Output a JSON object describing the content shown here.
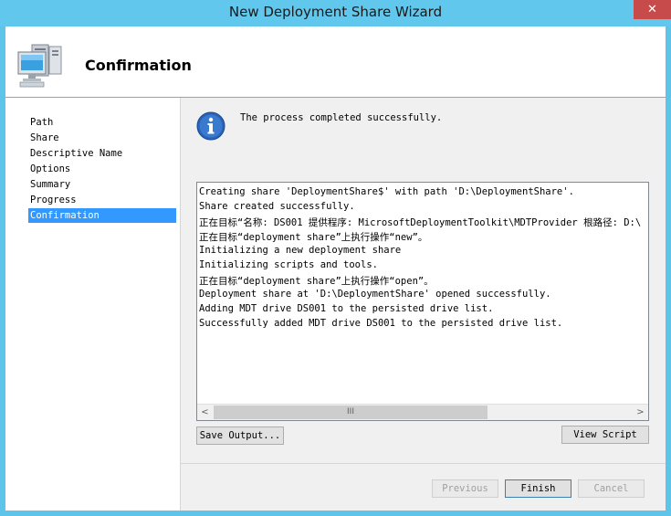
{
  "window": {
    "title": "New Deployment Share Wizard",
    "close_glyph": "✕"
  },
  "header": {
    "title": "Confirmation",
    "icon": "computer-icon"
  },
  "nav": {
    "items": [
      "Path",
      "Share",
      "Descriptive Name",
      "Options",
      "Summary",
      "Progress",
      "Confirmation"
    ],
    "selected": "Confirmation"
  },
  "status": {
    "icon": "info-icon",
    "text": "The process completed successfully."
  },
  "output": {
    "lines": [
      "Creating share 'DeploymentShare$' with path 'D:\\DeploymentShare'.",
      "Share created successfully.",
      "正在目标“名称: DS001 提供程序: MicrosoftDeploymentToolkit\\MDTProvider 根路径: D:\\",
      "正在目标“deployment share”上执行操作“new”。",
      "Initializing a new deployment share",
      "Initializing scripts and tools.",
      "正在目标“deployment share”上执行操作“open”。",
      "Deployment share at 'D:\\DeploymentShare' opened successfully.",
      "Adding MDT drive DS001 to the persisted drive list.",
      "Successfully added MDT drive DS001 to the persisted drive list."
    ],
    "scroll_left_glyph": "<",
    "scroll_right_glyph": ">",
    "scroll_thumb_glyph": "III"
  },
  "buttons": {
    "save_output": "Save Output...",
    "view_script": "View Script",
    "previous": "Previous",
    "finish": "Finish",
    "cancel": "Cancel"
  }
}
